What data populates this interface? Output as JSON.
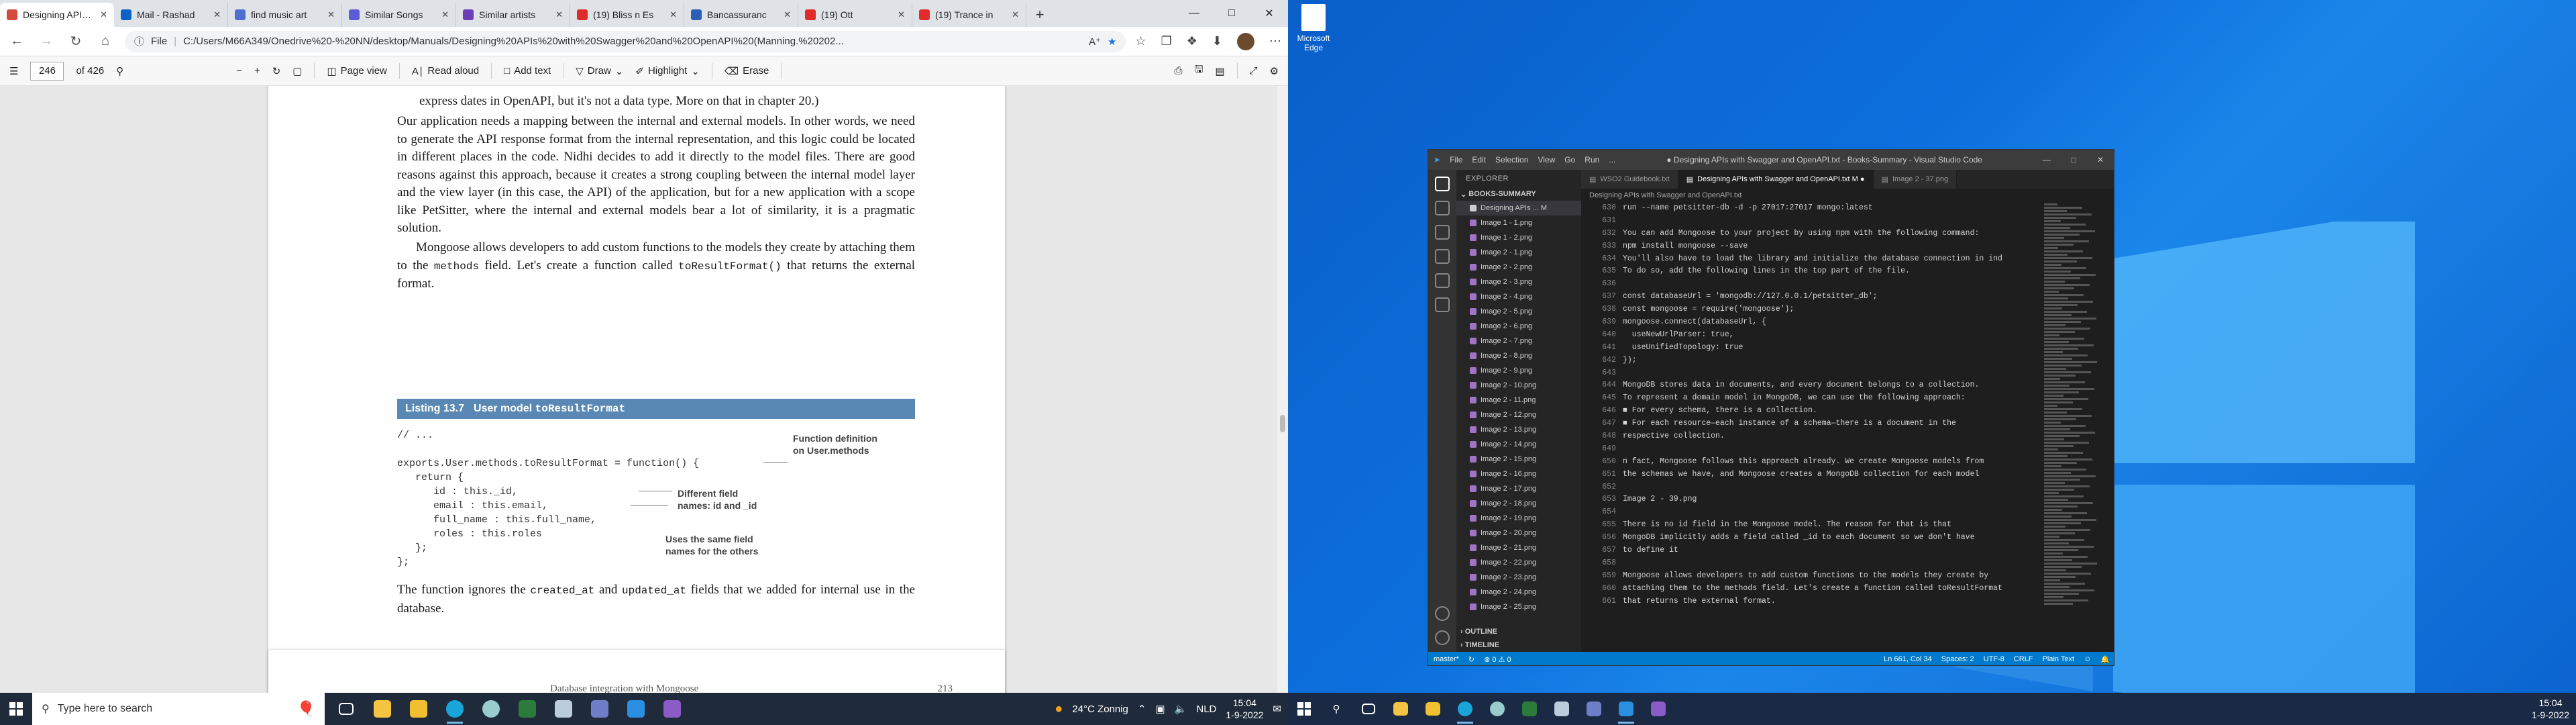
{
  "browser": {
    "tabs": [
      {
        "title": "Designing APIs w",
        "color": "#d24b3e",
        "active": true
      },
      {
        "title": "Mail - Rashad",
        "color": "#0a64c8",
        "active": false
      },
      {
        "title": "find music art",
        "color": "#4f6fd0",
        "active": false
      },
      {
        "title": "Similar Songs",
        "color": "#5b5bd6",
        "active": false
      },
      {
        "title": "Similar artists",
        "color": "#6a3fb5",
        "active": false
      },
      {
        "title": "(19) Bliss n Es",
        "color": "#e12b2b",
        "active": false
      },
      {
        "title": "Bancassuranc",
        "color": "#2b5fb5",
        "active": false
      },
      {
        "title": "(19) Ott",
        "color": "#e12b2b",
        "active": false
      },
      {
        "title": "(19) Trance in",
        "color": "#e12b2b",
        "active": false
      }
    ],
    "file_label": "File",
    "url": "C:/Users/M66A349/Onedrive%20-%20NN/desktop/Manuals/Designing%20APIs%20with%20Swagger%20and%20OpenAPI%20(Manning.%20202..."
  },
  "pdf_toolbar": {
    "page_number": "246",
    "page_count": "of 426",
    "page_view": "Page view",
    "read_aloud": "Read aloud",
    "add_text": "Add text",
    "draw": "Draw",
    "highlight": "Highlight",
    "erase": "Erase"
  },
  "pdf_page": {
    "line0": "express dates in OpenAPI, but it's not a data type. More on that in chapter 20.)",
    "para1": "Our application needs a mapping between the internal and external models. In other words, we need to generate the API response format from the internal representation, and this logic could be located in different places in the code. Nidhi decides to add it directly to the model files. There are good reasons against this approach, because it creates a strong coupling between the internal model layer and the view layer (in this case, the API) of the application, but for a new application with a scope like PetSitter, where the internal and external models bear a lot of similarity, it is a pragmatic solution.",
    "para2a": "Mongoose allows developers to add custom functions to the models they create by attaching them to the",
    "para2_code1": "methods",
    "para2b": "field. Let's create a function called",
    "para2_code2": "toResultFormat()",
    "para2c": "that returns the external format.",
    "listing_num": "Listing 13.7",
    "listing_title": "User model",
    "listing_code": "toResultFormat",
    "code_lines": [
      "// ...",
      "",
      "exports.User.methods.toResultFormat = function() {",
      "   return {",
      "      id : this._id,",
      "      email : this.email,",
      "      full_name : this.full_name,",
      "      roles : this.roles",
      "   };",
      "};"
    ],
    "anno1": "Function definition\non User.methods",
    "anno2": "Different field\nnames: id and _id",
    "anno3": "Uses the same field\nnames for the others",
    "para3a": "The function ignores the",
    "para3_code1": "created_at",
    "para3b": "and",
    "para3_code2": "updated_at",
    "para3c": "fields that we added for internal use in the database.",
    "next_page_footer_left": "Database integration with Mongoose",
    "next_page_footer_right": "213"
  },
  "taskbar_left": {
    "search_placeholder": "Type here to search",
    "weather": "24°C  Zonnig",
    "lang": "NLD",
    "time": "15:04",
    "date": "1-9-2022"
  },
  "desktop": {
    "icon_label": "Microsoft Edge"
  },
  "vscode": {
    "menu": [
      "File",
      "Edit",
      "Selection",
      "View",
      "Go",
      "Run",
      "..."
    ],
    "title": "● Designing APIs with Swagger and OpenAPI.txt - Books-Summary - Visual Studio Code",
    "explorer": "EXPLORER",
    "folder": "BOOKS-SUMMARY",
    "files": [
      "Designing APIs ...  M",
      "Image 1 - 1.png",
      "Image 1 - 2.png",
      "Image 2 - 1.png",
      "Image 2 - 2.png",
      "Image 2 - 3.png",
      "Image 2 - 4.png",
      "Image 2 - 5.png",
      "Image 2 - 6.png",
      "Image 2 - 7.png",
      "Image 2 - 8.png",
      "Image 2 - 9.png",
      "Image 2 - 10.png",
      "Image 2 - 11.png",
      "Image 2 - 12.png",
      "Image 2 - 13.png",
      "Image 2 - 14.png",
      "Image 2 - 15.png",
      "Image 2 - 16.png",
      "Image 2 - 17.png",
      "Image 2 - 18.png",
      "Image 2 - 19.png",
      "Image 2 - 20.png",
      "Image 2 - 21.png",
      "Image 2 - 22.png",
      "Image 2 - 23.png",
      "Image 2 - 24.png",
      "Image 2 - 25.png"
    ],
    "outline": "OUTLINE",
    "timeline": "TIMELINE",
    "tabs": [
      {
        "label": "WSO2 Guidebook.txt",
        "active": false
      },
      {
        "label": "Designing APIs with Swagger and OpenAPI.txt  M ●",
        "active": true
      },
      {
        "label": "Image 2 - 37.png",
        "active": false
      }
    ],
    "breadcrumb": "Designing APIs with Swagger and OpenAPI.txt",
    "line_numbers": [
      "630",
      "631",
      "632",
      "633",
      "634",
      "635",
      "636",
      "637",
      "638",
      "639",
      "640",
      "641",
      "642",
      "643",
      "644",
      "645",
      "646",
      "647",
      "648",
      "649",
      "650",
      "651",
      "652",
      "653",
      "654",
      "655",
      "656",
      "657",
      "658",
      "659",
      "660",
      "661"
    ],
    "lines": [
      "run --name petsitter-db -d -p 27017:27017 mongo:latest",
      "",
      "You can add Mongoose to your project by using npm with the following command:",
      "npm install mongoose --save",
      "You'll also have to load the library and initialize the database connection in ind",
      "To do so, add the following lines in the top part of the file.",
      "",
      "const databaseUrl = 'mongodb://127.0.0.1/petsitter_db';",
      "const mongoose = require('mongoose');",
      "mongoose.connect(databaseUrl, {",
      "  useNewUrlParser: true,",
      "  useUnifiedTopology: true",
      "});",
      "",
      "MongoDB stores data in documents, and every document belongs to a collection.",
      "To represent a domain model in MongoDB, we can use the following approach:",
      "■ For every schema, there is a collection.",
      "■ For each resource—each instance of a schema—there is a document in the",
      "respective collection.",
      "",
      "n fact, Mongoose follows this approach already. We create Mongoose models from",
      "the schemas we have, and Mongoose creates a MongoDB collection for each model",
      "",
      "Image 2 - 39.png",
      "",
      "There is no id field in the Mongoose model. The reason for that is that",
      "MongoDB implicitly adds a field called _id to each document so we don't have",
      "to define it",
      "",
      "Mongoose allows developers to add custom functions to the models they create by",
      "attaching them to the methods field. Let's create a function called toResultFormat",
      "that returns the external format."
    ],
    "status": {
      "branch": "master*",
      "problems": "⊗ 0 ⚠ 0",
      "position": "Ln 661, Col 34",
      "spaces": "Spaces: 2",
      "encoding": "UTF-8",
      "eol": "CRLF",
      "language": "Plain Text"
    }
  },
  "taskbar_right": {
    "time": "15:04",
    "date": "1-9-2022"
  }
}
